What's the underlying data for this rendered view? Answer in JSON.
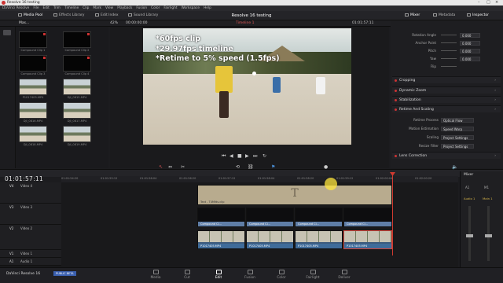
{
  "window": {
    "title": "Resolve 16 testing"
  },
  "menu": [
    "DaVinci Resolve",
    "File",
    "Edit",
    "Trim",
    "Timeline",
    "Clip",
    "Mark",
    "View",
    "Playback",
    "Fusion",
    "Color",
    "Fairlight",
    "Workspace",
    "Help"
  ],
  "toolbar": {
    "media_pool": "Media Pool",
    "effects_library": "Effects Library",
    "edit_index": "Edit Index",
    "sound_library": "Sound Library",
    "project_title": "Resolve 16 testing",
    "mixer": "Mixer",
    "metadata": "Metadata",
    "inspector": "Inspector"
  },
  "panelbar": {
    "bin_name": "Mas...",
    "zoom": "42%",
    "source_tc": "00:00:00:00",
    "timeline_name": "Timeline 1",
    "record_tc": "01:01:57:11",
    "clip_name": "P1017405.MP4"
  },
  "media_pool": {
    "clips": [
      "Compound Clip 1",
      "Compound Clip 2",
      "Compound Clip 3",
      "Compound Clip 4",
      "P1017405.MP4",
      "DJI_0815.MP4",
      "DJI_0816.MP4",
      "DJI_0817.MP4",
      "DJI_0818.MP4",
      "DJI_0819.MP4"
    ]
  },
  "viewer": {
    "overlay_lines": [
      "*60fps clip",
      "*29.97fps timeline",
      "*Retime to 5% speed (1.5fps)"
    ]
  },
  "inspector": {
    "transform_rows": [
      {
        "label": "Rotation Angle",
        "value": "0.000"
      },
      {
        "label": "Anchor Point",
        "value": "0.000"
      },
      {
        "label": "Pitch",
        "value": "0.000"
      },
      {
        "label": "Yaw",
        "value": "0.000"
      },
      {
        "label": "Flip",
        "value": ""
      }
    ],
    "sections": [
      "Cropping",
      "Dynamic Zoom",
      "Stabilization",
      "Retime And Scaling",
      "Lens Correction"
    ],
    "retime_rows": [
      {
        "label": "Retime Process",
        "value": "Optical Flow"
      },
      {
        "label": "Motion Estimation",
        "value": "Speed Warp"
      },
      {
        "label": "Scaling",
        "value": "Project Settings"
      },
      {
        "label": "Resize Filter",
        "value": "Project Settings"
      }
    ]
  },
  "timeline": {
    "timecode": "01:01:57:11",
    "ruler": [
      "01:01:54:20",
      "01:01:55:12",
      "01:01:56:04",
      "01:01:56:20",
      "01:01:57:12",
      "01:01:58:04",
      "01:01:58:20",
      "01:01:59:12",
      "01:02:00:04",
      "01:02:00:20"
    ],
    "tracks": [
      {
        "id": "V4",
        "name": "Video 4"
      },
      {
        "id": "V3",
        "name": "Video 3"
      },
      {
        "id": "V2",
        "name": "Video 2"
      },
      {
        "id": "V1",
        "name": "Video 1"
      },
      {
        "id": "A1",
        "name": "Audio 1",
        "ch": "2.0"
      }
    ],
    "title_clip": {
      "label": "Text - T4Mfds.clip",
      "glyph": "T"
    },
    "compound_label": "Compound Cl...",
    "video_label": "P1017405.MP4"
  },
  "mixer": {
    "title": "Mixer",
    "channels": [
      "A1",
      "M1"
    ],
    "strip": [
      "Audio 1",
      "Main 1"
    ]
  },
  "bottombar": {
    "app": "DaVinci Resolve 16",
    "badge": "PUBLIC BETA",
    "pages": [
      "Media",
      "Cut",
      "Edit",
      "Fusion",
      "Color",
      "Fairlight",
      "Deliver"
    ]
  },
  "colors": {
    "accent": "#d0443a",
    "clip_blue": "#3f6c9a",
    "title_clip": "#b8ab8e"
  }
}
